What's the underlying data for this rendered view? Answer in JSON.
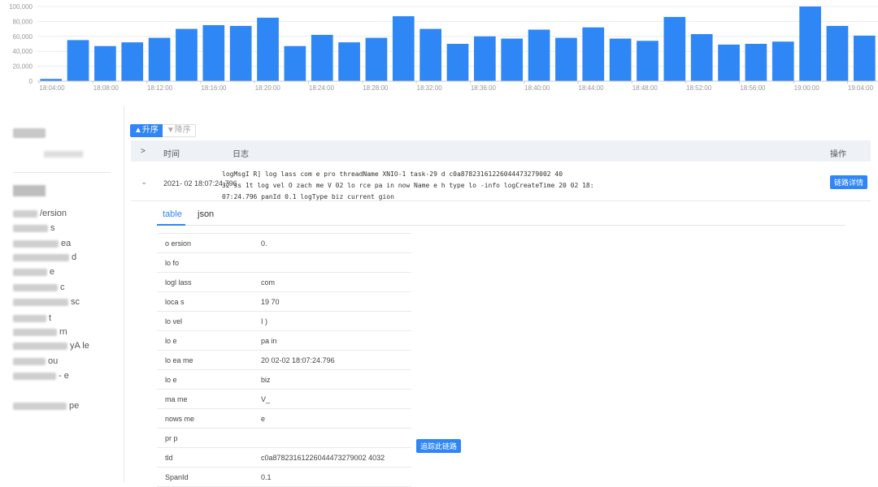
{
  "chart_data": {
    "type": "bar",
    "title": "",
    "xlabel": "",
    "ylabel": "",
    "ylim": [
      0,
      100000
    ],
    "yticks": [
      "0",
      "20,000",
      "40,000",
      "60,000",
      "80,000",
      "100,000"
    ],
    "xtick_labels": [
      "18:04:00",
      "18:08:00",
      "18:12:00",
      "18:16:00",
      "18:20:00",
      "18:24:00",
      "18:28:00",
      "18:32:00",
      "18:36:00",
      "18:40:00",
      "18:44:00",
      "18:48:00",
      "18:52:00",
      "18:56:00",
      "19:00:00",
      "19:04:00"
    ],
    "values": [
      3000,
      55000,
      47000,
      52000,
      58000,
      70000,
      75000,
      74000,
      85000,
      47000,
      62000,
      52000,
      58000,
      87000,
      70000,
      50000,
      60000,
      57000,
      69000,
      58000,
      72000,
      57000,
      54000,
      86000,
      63000,
      49000,
      50000,
      53000,
      100000,
      74000,
      61000
    ],
    "bar_color": "#2f86f5",
    "grid": true
  },
  "sidebar": {
    "items": [
      "/ersion",
      "s",
      "ea",
      "d",
      "e",
      "c",
      "sc",
      "t",
      "rn",
      "yA le",
      "ou",
      "- e",
      "pe"
    ]
  },
  "sort": {
    "asc_label": "▲升序",
    "desc_label": "▼降序"
  },
  "table": {
    "headers": {
      "expand": ">",
      "time": "时间",
      "log": "日志",
      "action": "操作"
    },
    "row": {
      "expand_icon": "⌄",
      "time": "2021-   02 18:07:24.796",
      "log_line1": "logMsgI          R] log   lass  com                               e  pro         threadName  XNIO-1 task-29        d  c0a87823161226044473279002 40",
      "log_line2": "32  ss  1t  log  vel  O  zach  me  V  02  lo  rce  pa  in  now  Name  e  h  type  lo  -info  logCreateTime  20   02 18:",
      "log_line3": "07:24.796       panId  0.1  logType  biz  current      gion",
      "action_label": "链路详情"
    }
  },
  "tabs": {
    "table_label": "table",
    "json_label": "json"
  },
  "detail_rows": [
    {
      "key": "o  ersion",
      "value": "0."
    },
    {
      "key": "lo  fo",
      "value": ""
    },
    {
      "key": "logl  lass",
      "value": "com"
    },
    {
      "key": "loca  s",
      "value": "19   70"
    },
    {
      "key": "lo  vel",
      "value": "I  )"
    },
    {
      "key": "lo  e",
      "value": "pa  in"
    },
    {
      "key": "lo  ea  me",
      "value": "20   02-02 18:07:24.796"
    },
    {
      "key": "lo  e",
      "value": "biz"
    },
    {
      "key": "ma  me",
      "value": "V_"
    },
    {
      "key": "nows  me",
      "value": "e"
    },
    {
      "key": "pr  p",
      "value": ""
    },
    {
      "key": "   tld",
      "value": "c0a87823161226044473279002 4032"
    },
    {
      "key": "  SpanId",
      "value": "0.1"
    }
  ],
  "trace_label": "追踪此链路"
}
